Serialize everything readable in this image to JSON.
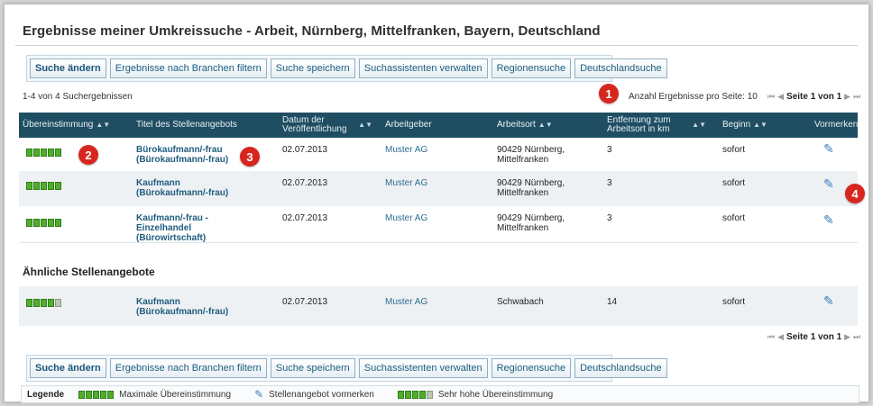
{
  "page": {
    "title": "Ergebnisse meiner Umkreissuche - Arbeit, Nürnberg, Mittelfranken, Bayern, Deutschland"
  },
  "toolbar": {
    "buttons": [
      "Suche ändern",
      "Ergebnisse nach Branchen filtern",
      "Suche speichern",
      "Suchassistenten verwalten",
      "Regionensuche",
      "Deutschlandsuche"
    ]
  },
  "results": {
    "count_text": "1-4 von 4 Suchergebnissen",
    "per_page_text": "Anzahl Ergebnisse pro Seite: 10",
    "page_text": "Seite 1 von 1"
  },
  "table": {
    "headers": [
      "Übereinstimmung",
      "Titel des Stellenangebots",
      "Datum der Veröffentlichung",
      "Arbeitgeber",
      "Arbeitsort",
      "Entfernung zum Arbeitsort in km",
      "Beginn",
      "Vormerken"
    ],
    "rows": [
      {
        "match_level": 5,
        "title": "Bürokaufmann/-frau (Bürokaufmann/-frau)",
        "date": "02.07.2013",
        "employer": "Muster AG",
        "location": "90429 Nürnberg, Mittelfranken",
        "distance": "3",
        "start": "sofort"
      },
      {
        "match_level": 5,
        "title": "Kaufmann (Bürokaufmann/-frau)",
        "date": "02.07.2013",
        "employer": "Muster AG",
        "location": "90429 Nürnberg, Mittelfranken",
        "distance": "3",
        "start": "sofort"
      },
      {
        "match_level": 5,
        "title": "Kaufmann/-frau - Einzelhandel (Bürowirtschaft)",
        "date": "02.07.2013",
        "employer": "Muster AG",
        "location": "90429 Nürnberg, Mittelfranken",
        "distance": "3",
        "start": "sofort"
      }
    ],
    "similar_heading": "Ähnliche Stellenangebote",
    "similar_rows": [
      {
        "match_level": 4,
        "title": "Kaufmann (Bürokaufmann/-frau)",
        "date": "02.07.2013",
        "employer": "Muster AG",
        "location": "Schwabach",
        "distance": "14",
        "start": "sofort"
      }
    ]
  },
  "legend": {
    "label": "Legende",
    "items": [
      "Maximale Übereinstimmung",
      "Stellenangebot vormerken",
      "Sehr hohe Übereinstimmung"
    ]
  },
  "markers": [
    "1",
    "2",
    "3",
    "4"
  ],
  "colors": {
    "header_bg": "#1f4e63",
    "match_green": "#4fae2c",
    "marker_red": "#d7261e",
    "link_blue": "#1e5c7e"
  },
  "icons": {
    "sort": "sort-arrows-icon",
    "bookmark": "pin-icon",
    "pager_first": "first-page-icon",
    "pager_prev": "prev-page-icon",
    "pager_next": "next-page-icon",
    "pager_last": "last-page-icon"
  }
}
